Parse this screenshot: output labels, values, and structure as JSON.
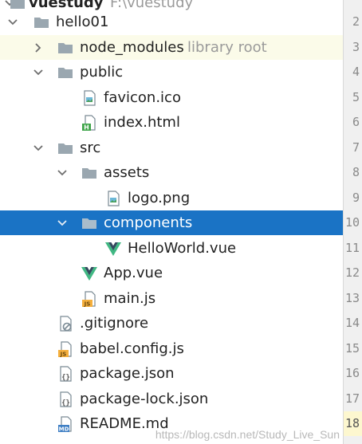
{
  "project": {
    "name": "vuestudy",
    "path": "F:\\vuestudy"
  },
  "tree": [
    {
      "label": "hello01",
      "hint": "",
      "type": "folder"
    },
    {
      "label": "node_modules",
      "hint": "library root",
      "type": "folder"
    },
    {
      "label": "public",
      "hint": "",
      "type": "folder"
    },
    {
      "label": "favicon.ico",
      "hint": "",
      "type": "image"
    },
    {
      "label": "index.html",
      "hint": "",
      "type": "html"
    },
    {
      "label": "src",
      "hint": "",
      "type": "folder"
    },
    {
      "label": "assets",
      "hint": "",
      "type": "folder"
    },
    {
      "label": "logo.png",
      "hint": "",
      "type": "image"
    },
    {
      "label": "components",
      "hint": "",
      "type": "folder"
    },
    {
      "label": "HelloWorld.vue",
      "hint": "",
      "type": "vue"
    },
    {
      "label": "App.vue",
      "hint": "",
      "type": "vue"
    },
    {
      "label": "main.js",
      "hint": "",
      "type": "js"
    },
    {
      "label": ".gitignore",
      "hint": "",
      "type": "gitignore"
    },
    {
      "label": "babel.config.js",
      "hint": "",
      "type": "js"
    },
    {
      "label": "package.json",
      "hint": "",
      "type": "json"
    },
    {
      "label": "package-lock.json",
      "hint": "",
      "type": "json"
    },
    {
      "label": "README.md",
      "hint": "",
      "type": "md"
    }
  ],
  "line_numbers": [
    "2",
    "3",
    "4",
    "5",
    "6",
    "7",
    "8",
    "9",
    "10",
    "11",
    "12",
    "13",
    "14",
    "15",
    "16",
    "17",
    "18"
  ],
  "watermark": "https://blog.csdn.net/Study_Live_Sun",
  "colors": {
    "selection": "#1a73c5",
    "library_row": "#fbfbe9",
    "folder": "#9aa7b0",
    "vue_green": "#41b883",
    "vue_dark": "#34495e",
    "js_badge": "#f4af3d",
    "html_badge": "#3fa54a"
  }
}
